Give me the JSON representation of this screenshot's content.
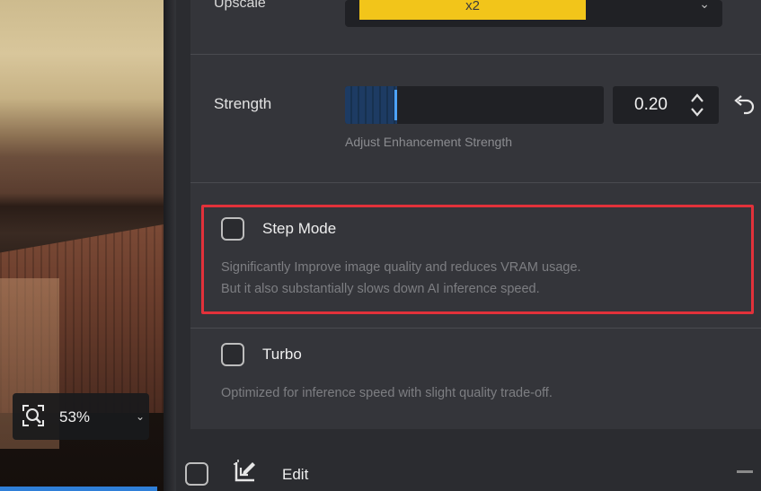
{
  "preview": {
    "zoom_value": "53%"
  },
  "panel": {
    "upscale": {
      "label": "Upscale",
      "value": "x2"
    },
    "strength": {
      "label": "Strength",
      "value": "0.20",
      "value_fraction": 0.2,
      "hint": "Adjust Enhancement Strength"
    },
    "step_mode": {
      "title": "Step Mode",
      "desc_line1": "Significantly Improve image quality and reduces VRAM usage.",
      "desc_line2": "But it also substantially slows down AI inference speed.",
      "checked": false
    },
    "turbo": {
      "title": "Turbo",
      "desc": "Optimized for inference speed with slight quality trade-off.",
      "checked": false
    }
  },
  "edit": {
    "label": "Edit",
    "checked": false
  },
  "colors": {
    "accent": "#f2c51a",
    "slider_thumb": "#4da3ff",
    "highlight": "#e2313a",
    "panel_bg": "#34353a"
  }
}
